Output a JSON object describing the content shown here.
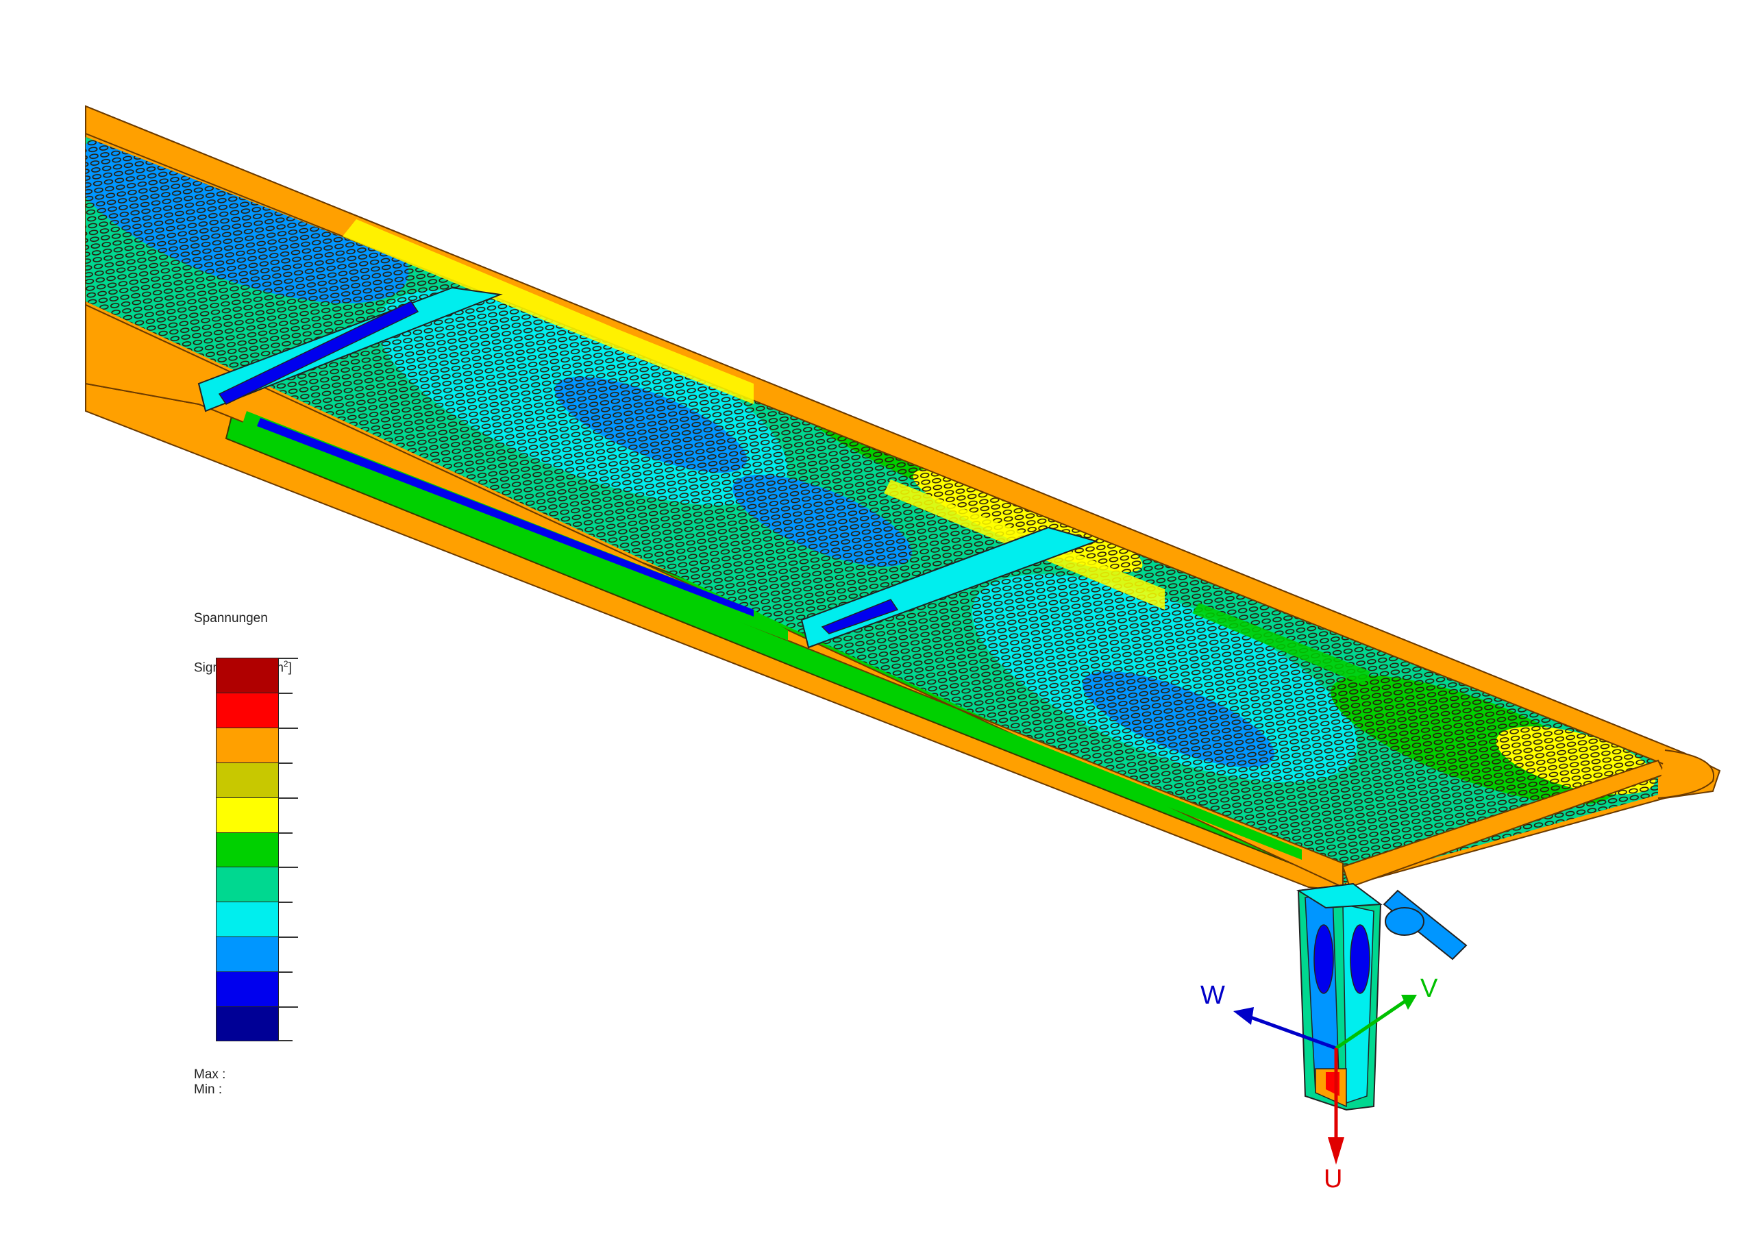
{
  "legend": {
    "title_line1": "Spannungen",
    "title_line2": "Sigma-v [N/mm",
    "title_sup": "2",
    "title_end": "]",
    "max_label": "Max :",
    "min_label": "Min :",
    "bands": [
      "#b00000",
      "#ff0000",
      "#ffa000",
      "#c8c800",
      "#ffff00",
      "#00d000",
      "#00d890",
      "#00eeee",
      "#0096ff",
      "#0000ee",
      "#000096"
    ]
  },
  "axes": {
    "u_label": "U",
    "v_label": "V",
    "w_label": "W",
    "u_color": "#e00000",
    "v_color": "#00c000",
    "w_color": "#0000c8"
  }
}
